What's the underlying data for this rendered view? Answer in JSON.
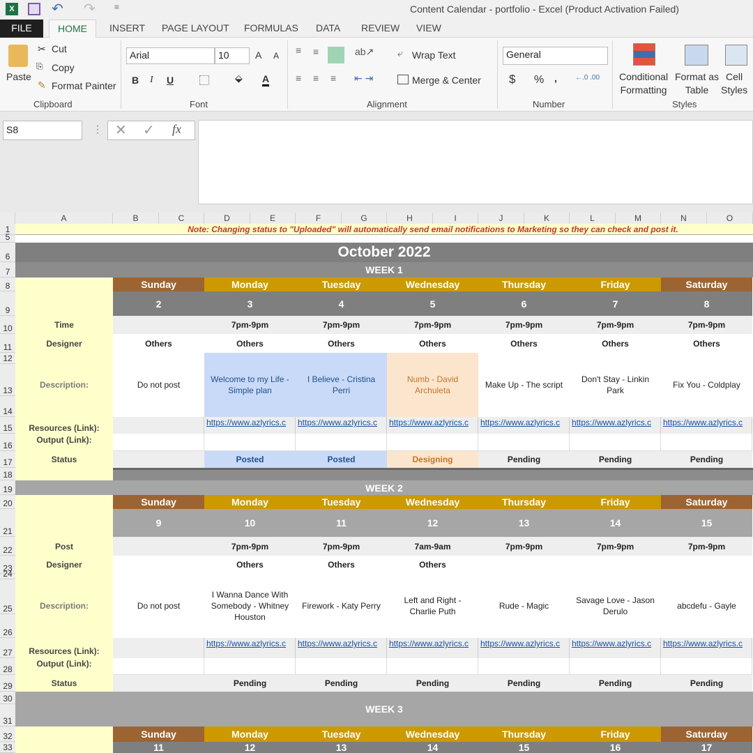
{
  "window": {
    "title": "Content Calendar - portfolio - Excel (Product Activation Failed)"
  },
  "ribbon_tabs": [
    "FILE",
    "HOME",
    "INSERT",
    "PAGE LAYOUT",
    "FORMULAS",
    "DATA",
    "REVIEW",
    "VIEW"
  ],
  "active_tab": "HOME",
  "clipboard": {
    "paste": "Paste",
    "cut": "Cut",
    "copy": "Copy",
    "format_painter": "Format Painter",
    "group": "Clipboard"
  },
  "font": {
    "name": "Arial",
    "size": "10",
    "group": "Font",
    "bold": "B",
    "italic": "I",
    "underline": "U",
    "grow": "A",
    "shrink": "A",
    "color": "A"
  },
  "alignment": {
    "wrap_text": "Wrap Text",
    "merge_center": "Merge & Center",
    "group": "Alignment"
  },
  "number": {
    "format": "General",
    "currency": "$",
    "percent": "%",
    "comma": ",",
    "group": "Number"
  },
  "styles": {
    "conditional_1": "Conditional",
    "conditional_2": "Formatting",
    "format_table_1": "Format as",
    "format_table_2": "Table",
    "cell_styles_1": "Cell",
    "cell_styles_2": "Styles",
    "group": "Styles"
  },
  "formula_bar": {
    "name_box": "S8",
    "fx": "fx",
    "value": ""
  },
  "columns": [
    "A",
    "B",
    "C",
    "D",
    "E",
    "F",
    "G",
    "H",
    "I",
    "J",
    "K",
    "L",
    "M",
    "N",
    "O"
  ],
  "note": "Note: Changing status to \"Uploaded\" will automatically send email notifications to Marketing so they can check and post it.",
  "month_title": "October 2022",
  "days": [
    "Sunday",
    "Monday",
    "Tuesday",
    "Wednesday",
    "Thursday",
    "Friday",
    "Saturday"
  ],
  "colors": {
    "weekend": "#9c6432",
    "weekday": "#cc9900",
    "header_dark": "#7f7f7f",
    "label_bg": "#ffffcc",
    "posted_bg": "#c9daf8",
    "designing_bg": "#fce5cd"
  },
  "row_labels_w1": {
    "time": "Time",
    "designer": "Designer",
    "description": "Description:",
    "resources": "Resources (Link):",
    "output": "Output (Link):",
    "status": "Status"
  },
  "row_labels_w2": {
    "time": "Post",
    "designer": "Designer",
    "description": "Description:",
    "resources": "Resources (Link):",
    "output": "Output (Link):",
    "status": "Status"
  },
  "weeks": [
    {
      "label": "WEEK 1",
      "dates": [
        "2",
        "3",
        "4",
        "5",
        "6",
        "7",
        "8"
      ],
      "times": [
        "",
        "7pm-9pm",
        "7pm-9pm",
        "7pm-9pm",
        "7pm-9pm",
        "7pm-9pm",
        "7pm-9pm"
      ],
      "designers": [
        "Others",
        "Others",
        "Others",
        "Others",
        "Others",
        "Others",
        "Others"
      ],
      "descriptions": [
        "Do not post",
        "Welcome to my Life - Simple plan",
        "I Believe - Cristina Perri",
        "Numb - David Archuleta",
        "Make Up - The script",
        "Don't Stay - Linkin Park",
        "Fix You - Coldplay"
      ],
      "resources": [
        "",
        "https://www.azlyrics.c",
        "https://www.azlyrics.c",
        "https://www.azlyrics.c",
        "https://www.azlyrics.c",
        "https://www.azlyrics.c",
        "https://www.azlyrics.c"
      ],
      "statuses": [
        "",
        "Posted",
        "Posted",
        "Designing",
        "Pending",
        "Pending",
        "Pending"
      ]
    },
    {
      "label": "WEEK 2",
      "dates": [
        "9",
        "10",
        "11",
        "12",
        "13",
        "14",
        "15"
      ],
      "times": [
        "",
        "7pm-9pm",
        "7pm-9pm",
        "7am-9am",
        "7pm-9pm",
        "7pm-9pm",
        "7pm-9pm"
      ],
      "designers": [
        "",
        "Others",
        "Others",
        "Others",
        "",
        "",
        ""
      ],
      "descriptions": [
        "Do not post",
        "I Wanna Dance With Somebody - Whitney Houston",
        "Firework - Katy Perry",
        "Left and Right - Charlie Puth",
        "Rude - Magic",
        "Savage Love - Jason Derulo",
        "abcdefu - Gayle"
      ],
      "resources": [
        "",
        "https://www.azlyrics.c",
        "https://www.azlyrics.c",
        "https://www.azlyrics.c",
        "https://www.azlyrics.c",
        "https://www.azlyrics.c",
        "https://www.azlyrics.c"
      ],
      "statuses": [
        "",
        "Pending",
        "Pending",
        "Pending",
        "Pending",
        "Pending",
        "Pending"
      ]
    },
    {
      "label": "WEEK 3",
      "dates": [
        "11",
        "12",
        "13",
        "14",
        "15",
        "16",
        "17"
      ]
    }
  ]
}
